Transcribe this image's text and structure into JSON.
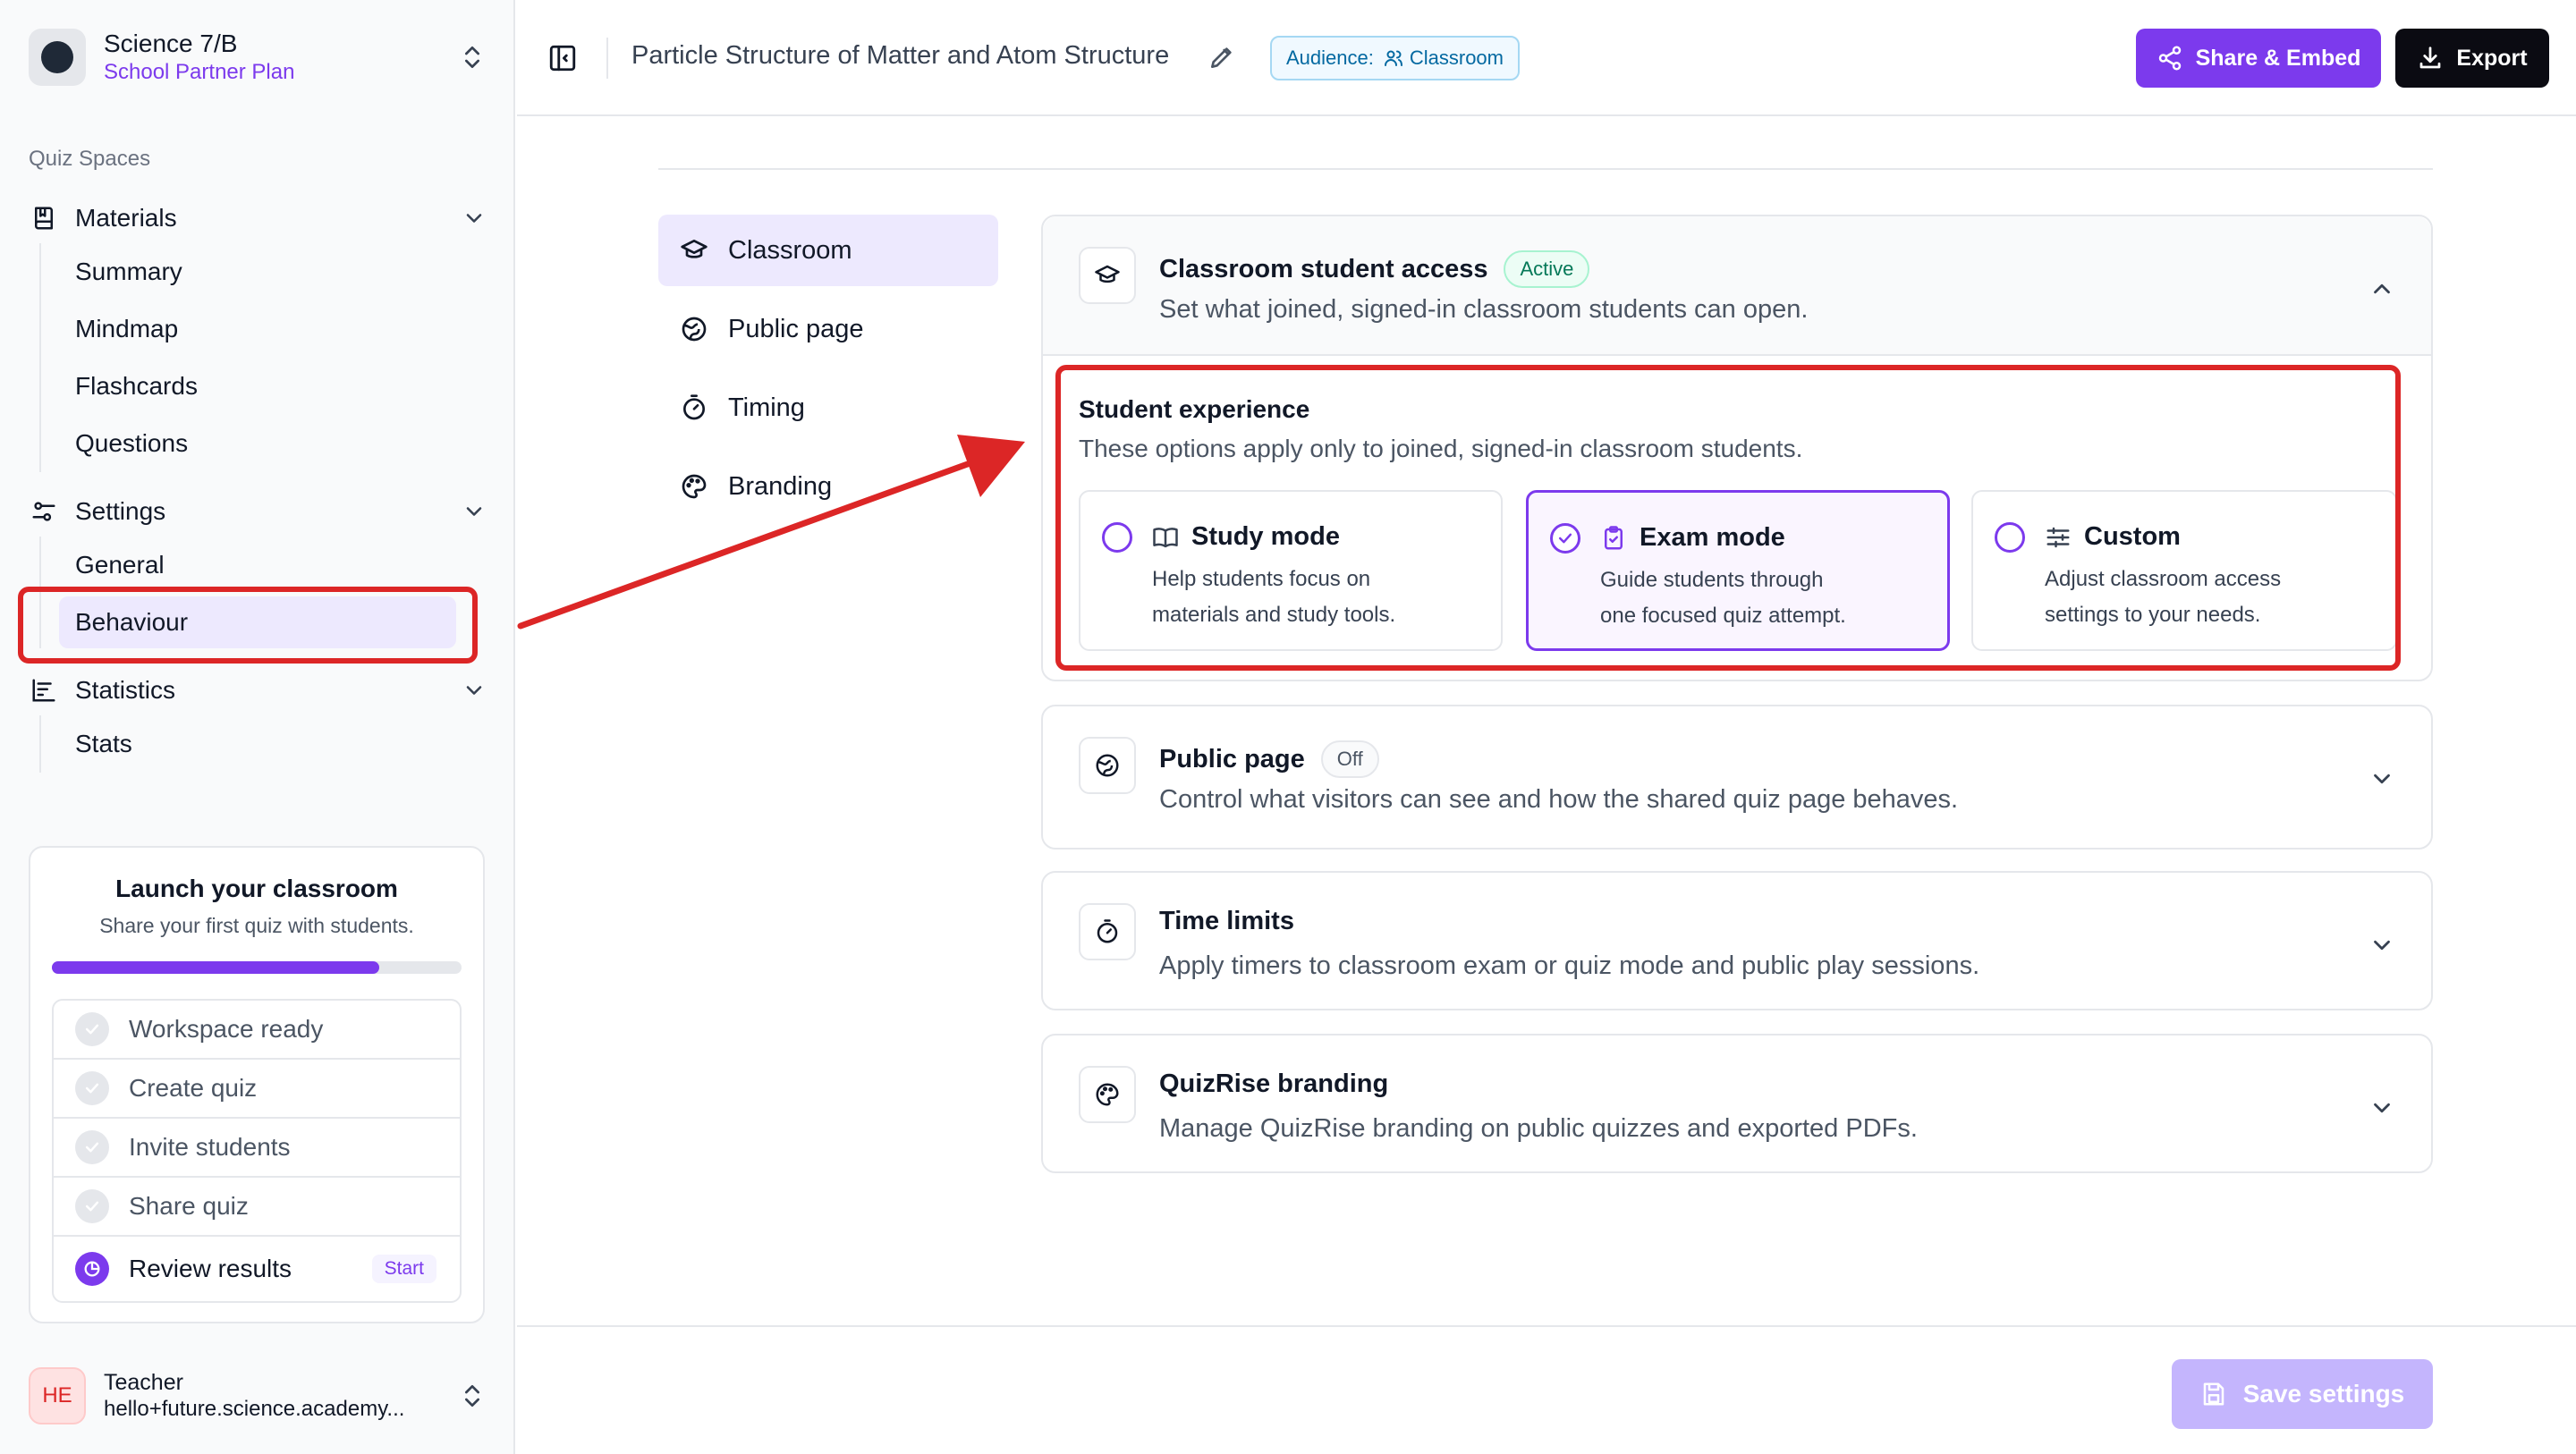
{
  "workspace": {
    "name": "Science 7/B",
    "plan": "School Partner Plan"
  },
  "sidebar": {
    "section_label": "Quiz Spaces",
    "groups": [
      {
        "label": "Materials",
        "icon": "book-icon",
        "items": [
          "Summary",
          "Mindmap",
          "Flashcards",
          "Questions"
        ]
      },
      {
        "label": "Settings",
        "icon": "sliders-icon",
        "items": [
          "General",
          "Behaviour"
        ]
      },
      {
        "label": "Statistics",
        "icon": "bar-chart-icon",
        "items": [
          "Stats"
        ]
      }
    ],
    "active_item": "Behaviour"
  },
  "launch": {
    "title": "Launch your classroom",
    "subtitle": "Share your first quiz with students.",
    "progress_fraction": 0.8,
    "steps": [
      {
        "label": "Workspace ready",
        "done": true
      },
      {
        "label": "Create quiz",
        "done": true
      },
      {
        "label": "Invite students",
        "done": true
      },
      {
        "label": "Share quiz",
        "done": true
      },
      {
        "label": "Review results",
        "done": false,
        "action": "Start"
      }
    ]
  },
  "user": {
    "initials": "HE",
    "role": "Teacher",
    "email": "hello+future.science.academy..."
  },
  "topbar": {
    "title": "Particle Structure of Matter and Atom Structure",
    "audience_label": "Audience:",
    "audience_value": "Classroom",
    "share_label": "Share & Embed",
    "export_label": "Export"
  },
  "subnav": [
    {
      "label": "Classroom",
      "icon": "graduation-cap-icon",
      "active": true
    },
    {
      "label": "Public page",
      "icon": "globe-icon",
      "active": false
    },
    {
      "label": "Timing",
      "icon": "timer-icon",
      "active": false
    },
    {
      "label": "Branding",
      "icon": "palette-icon",
      "active": false
    }
  ],
  "cards": {
    "classroom": {
      "title": "Classroom student access",
      "status": "Active",
      "description": "Set what joined, signed-in classroom students can open.",
      "experience_title": "Student experience",
      "experience_subtitle": "These options apply only to joined, signed-in classroom students.",
      "modes": [
        {
          "title": "Study mode",
          "icon": "book-open-icon",
          "desc_line1": "Help students focus on",
          "desc_line2": "materials and study tools.",
          "selected": false
        },
        {
          "title": "Exam mode",
          "icon": "clipboard-check-icon",
          "desc_line1": "Guide students through",
          "desc_line2": "one focused quiz attempt.",
          "selected": true
        },
        {
          "title": "Custom",
          "icon": "sliders-icon",
          "desc_line1": "Adjust classroom access",
          "desc_line2": "settings to your needs.",
          "selected": false
        }
      ]
    },
    "public_page": {
      "title": "Public page",
      "status": "Off",
      "description": "Control what visitors can see and how the shared quiz page behaves."
    },
    "time_limits": {
      "title": "Time limits",
      "description": "Apply timers to classroom exam or quiz mode and public play sessions."
    },
    "branding": {
      "title": "QuizRise branding",
      "description": "Manage QuizRise branding on public quizzes and exported PDFs."
    }
  },
  "footer": {
    "save_label": "Save settings"
  },
  "colors": {
    "accent": "#7c3aed",
    "annotation": "#dc2626"
  }
}
